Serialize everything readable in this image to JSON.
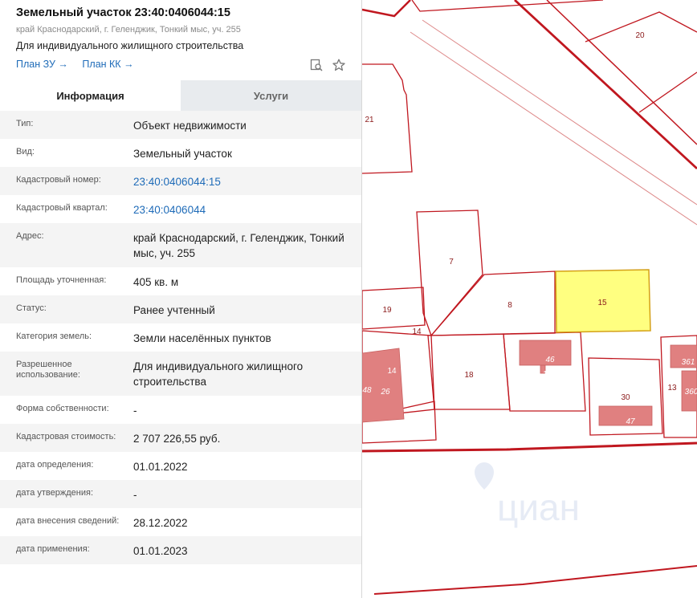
{
  "header": {
    "title": "Земельный участок 23:40:0406044:15",
    "address_small": "край Краснодарский, г. Геленджик, Тонкий мыс, уч. 255",
    "purpose": "Для индивидуального жилищного строительства",
    "link_plan_zu": "План ЗУ →",
    "link_plan_kk": "План КК →",
    "icons": [
      "search-document-icon",
      "star-icon"
    ]
  },
  "tabs": [
    {
      "label": "Информация",
      "active": true
    },
    {
      "label": "Услуги",
      "active": false
    }
  ],
  "rows": [
    {
      "label": "Тип:",
      "value": "Объект недвижимости"
    },
    {
      "label": "Вид:",
      "value": "Земельный участок"
    },
    {
      "label": "Кадастровый номер:",
      "value": "23:40:0406044:15"
    },
    {
      "label": "Кадастровый квартал:",
      "value": "23:40:0406044"
    },
    {
      "label": "Адрес:",
      "value": "край Краснодарский, г. Геленджик, Тонкий мыс, уч. 255"
    },
    {
      "label": "Площадь уточненная:",
      "value": "405 кв. м"
    },
    {
      "label": "Статус:",
      "value": "Ранее учтенный"
    },
    {
      "label": "Категория земель:",
      "value": "Земли населённых пунктов"
    },
    {
      "label": "Разрешенное использование:",
      "value": "Для индивидуального жилищного строительства"
    },
    {
      "label": "Форма собственности:",
      "value": "-"
    },
    {
      "label": "Кадастровая стоимость:",
      "value": "2 707 226,55 руб."
    },
    {
      "label": "дата определения:",
      "value": "01.01.2022"
    },
    {
      "label": "дата утверждения:",
      "value": "-"
    },
    {
      "label": "дата внесения сведений:",
      "value": "28.12.2022"
    },
    {
      "label": "дата применения:",
      "value": "01.01.2023"
    }
  ],
  "map": {
    "parcel_labels": [
      "20",
      "21",
      "7",
      "8",
      "15",
      "19",
      "14",
      "18",
      "46",
      "1",
      "30",
      "47",
      "13",
      "48",
      "26",
      "14",
      "361",
      "360"
    ],
    "watermark": "циан",
    "colors": {
      "boundary": "#c0171f",
      "selected_fill": "#ffff80",
      "selected_stroke": "#d4a017",
      "building_fill": "#e08080"
    }
  }
}
